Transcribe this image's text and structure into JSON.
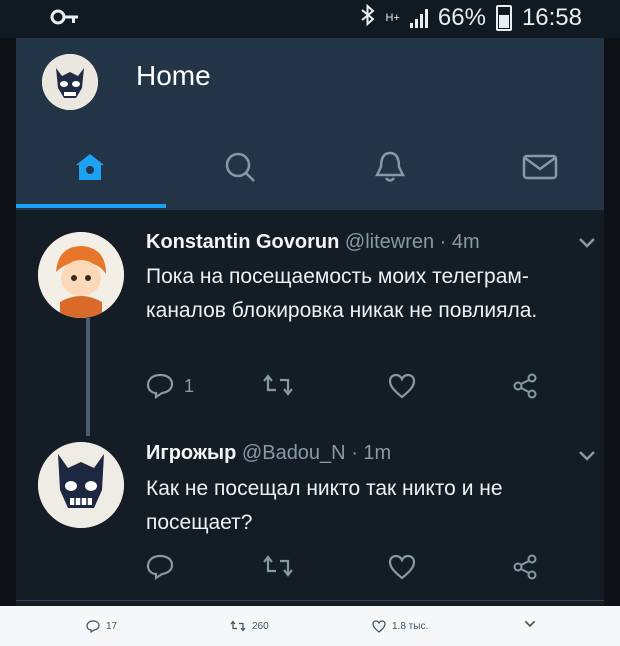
{
  "status_bar": {
    "key_icon": "key-icon",
    "bluetooth_icon": "bluetooth-icon",
    "network_type": "H+",
    "battery_percent": "66%",
    "time": "16:58"
  },
  "header": {
    "title": "Home",
    "tabs": [
      {
        "name": "home",
        "icon": "home-icon",
        "active": true
      },
      {
        "name": "search",
        "icon": "search-icon",
        "active": false
      },
      {
        "name": "notifications",
        "icon": "bell-icon",
        "active": false
      },
      {
        "name": "messages",
        "icon": "mail-icon",
        "active": false
      }
    ]
  },
  "tweets": [
    {
      "name": "Konstantin Govorun",
      "handle": "@litewren",
      "time": "4m",
      "text": "Пока на посещаемость моих телеграм-каналов блокировка никак не повлияла.",
      "reply_count": "1"
    },
    {
      "name": "Игрожыр",
      "handle": "@Badou_N",
      "time": "1m",
      "text": "Как не посещал никто так никто и не посещает?",
      "reply_count": ""
    }
  ],
  "bottom_bar": {
    "replies": "17",
    "retweets": "260",
    "likes": "1.8 тыс."
  },
  "colors": {
    "accent": "#1da1f2",
    "header_bg": "#243447",
    "body_bg": "#141d26",
    "muted": "#8899a6"
  }
}
